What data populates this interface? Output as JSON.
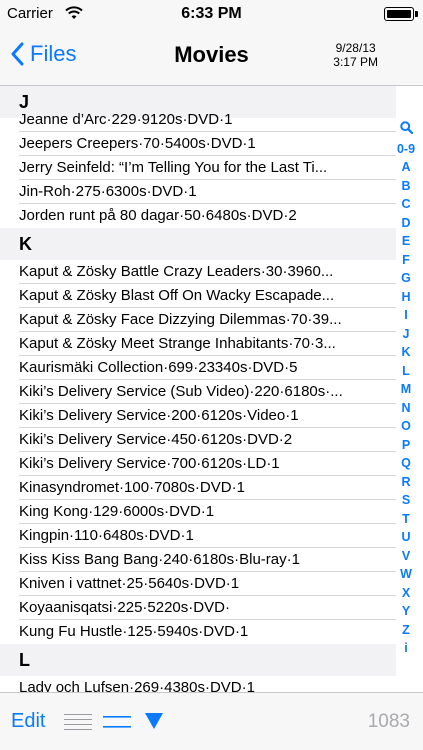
{
  "status": {
    "carrier": "Carrier",
    "time": "6:33 PM"
  },
  "nav": {
    "back_label": "Files",
    "title": "Movies",
    "date": "9/28/13",
    "time": "3:17 PM"
  },
  "sections": [
    {
      "letter": "J",
      "items": [
        "Jeanne d’Arc·229·9120s·DVD·1",
        "Jeepers Creepers·70·5400s·DVD·1",
        "Jerry Seinfeld: “I’m Telling You for the Last Ti...",
        "Jin-Roh·275·6300s·DVD·1",
        "Jorden runt på 80 dagar·50·6480s·DVD·2"
      ]
    },
    {
      "letter": "K",
      "items": [
        "Kaput & Zösky Battle Crazy Leaders·30·3960...",
        "Kaput & Zösky Blast Off On Wacky Escapade...",
        "Kaput & Zösky Face Dizzying Dilemmas·70·39...",
        "Kaput & Zösky Meet Strange Inhabitants·70·3...",
        "Kaurismäki Collection·699·23340s·DVD·5",
        "Kiki’s Delivery Service (Sub Video)·220·6180s·...",
        "Kiki’s Delivery Service·200·6120s·Video·1",
        "Kiki’s Delivery Service·450·6120s·DVD·2",
        "Kiki’s Delivery Service·700·6120s·LD·1",
        "Kinasyndromet·100·7080s·DVD·1",
        "King Kong·129·6000s·DVD·1",
        "Kingpin·110·6480s·DVD·1",
        "Kiss Kiss Bang Bang·240·6180s·Blu-ray·1",
        "Kniven i vattnet·25·5640s·DVD·1",
        "Koyaanisqatsi·225·5220s·DVD·",
        "Kung Fu Hustle·125·5940s·DVD·1"
      ]
    },
    {
      "letter": "L",
      "items": [
        "Lady och Lufsen·269·4380s·DVD·1"
      ]
    }
  ],
  "index": [
    "0-9",
    "A",
    "B",
    "C",
    "D",
    "E",
    "F",
    "G",
    "H",
    "I",
    "J",
    "K",
    "L",
    "M",
    "N",
    "O",
    "P",
    "Q",
    "R",
    "S",
    "T",
    "U",
    "V",
    "W",
    "X",
    "Y",
    "Z",
    "i"
  ],
  "toolbar": {
    "edit_label": "Edit",
    "count": "1083"
  },
  "colors": {
    "tint": "#0a7aff",
    "count_gray": "#a9a9ae"
  }
}
